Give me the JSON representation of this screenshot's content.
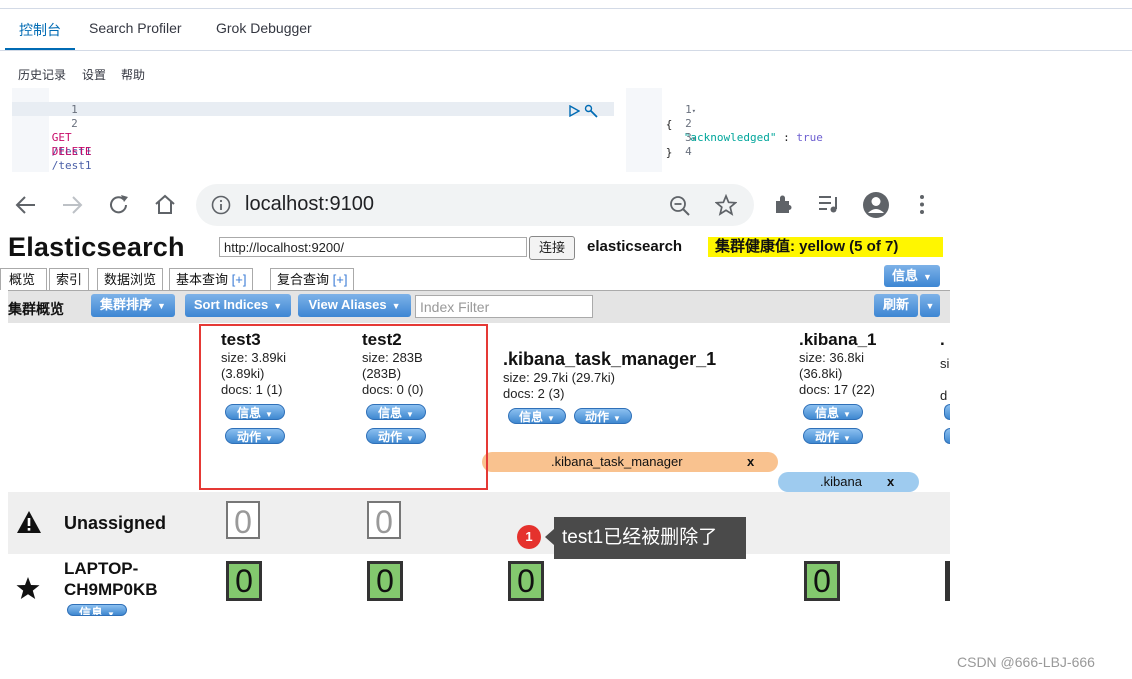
{
  "kibana": {
    "tabs": [
      "控制台",
      "Search Profiler",
      "Grok Debugger"
    ],
    "menu": [
      "历史记录",
      "设置",
      "帮助"
    ],
    "request_lines": [
      {
        "num": "1",
        "method": "GET",
        "path": "/test1"
      },
      {
        "num": "2",
        "method": "DELETE",
        "path": "/test1"
      }
    ],
    "response_lines": [
      {
        "num": "1",
        "fold": "▾",
        "text": "{"
      },
      {
        "num": "2",
        "key": "\"acknowledged\"",
        "sep": " : ",
        "value": "true"
      },
      {
        "num": "3",
        "fold": "▾",
        "text": "}"
      },
      {
        "num": "4",
        "text": ""
      }
    ]
  },
  "browser": {
    "url": "localhost:9100"
  },
  "es_head": {
    "title": "Elasticsearch",
    "connect_url": "http://localhost:9200/",
    "connect_label": "连接",
    "cluster_name": "elasticsearch",
    "health": "集群健康值: yellow (5 of 7)",
    "tabs": {
      "overview": "概览",
      "indices": "索引",
      "browser": "数据浏览",
      "basic_query": "基本查询",
      "compound_query": "复合查询",
      "plus": "[+]"
    },
    "info_button": "信息",
    "toolbar": {
      "label": "集群概览",
      "sort_cluster": "集群排序",
      "sort_indices": "Sort Indices",
      "view_aliases": "View Aliases",
      "filter_placeholder": "Index Filter",
      "refresh": "刷新"
    },
    "pill_info": "信息",
    "pill_action": "动作",
    "indices": [
      {
        "name": "test3",
        "size": "size: 3.89ki",
        "size2": "(3.89ki)",
        "docs": "docs: 1 (1)"
      },
      {
        "name": "test2",
        "size": "size: 283B",
        "size2": "(283B)",
        "docs": "docs: 0 (0)"
      },
      {
        "name": ".kibana_task_manager_1",
        "size": "size: 29.7ki (29.7ki)",
        "docs": "docs: 2 (3)"
      },
      {
        "name": ".kibana_1",
        "size": "size: 36.8ki",
        "size2": "(36.8ki)",
        "docs": "docs: 17 (22)"
      },
      {
        "name": ".",
        "size": "si",
        "docs": "d"
      }
    ],
    "aliases": [
      {
        "name": ".kibana_task_manager",
        "close": "x",
        "color": "#f9c28f"
      },
      {
        "name": ".kibana",
        "close": "x",
        "color": "#9ecbef"
      }
    ],
    "rows": {
      "unassigned": "Unassigned",
      "node_line1": "LAPTOP-",
      "node_line2": "CH9MP0KB",
      "shard_value": "0"
    }
  },
  "annotation": {
    "badge": "1",
    "text": "test1已经被删除了"
  },
  "watermark": "CSDN @666-LBJ-666"
}
